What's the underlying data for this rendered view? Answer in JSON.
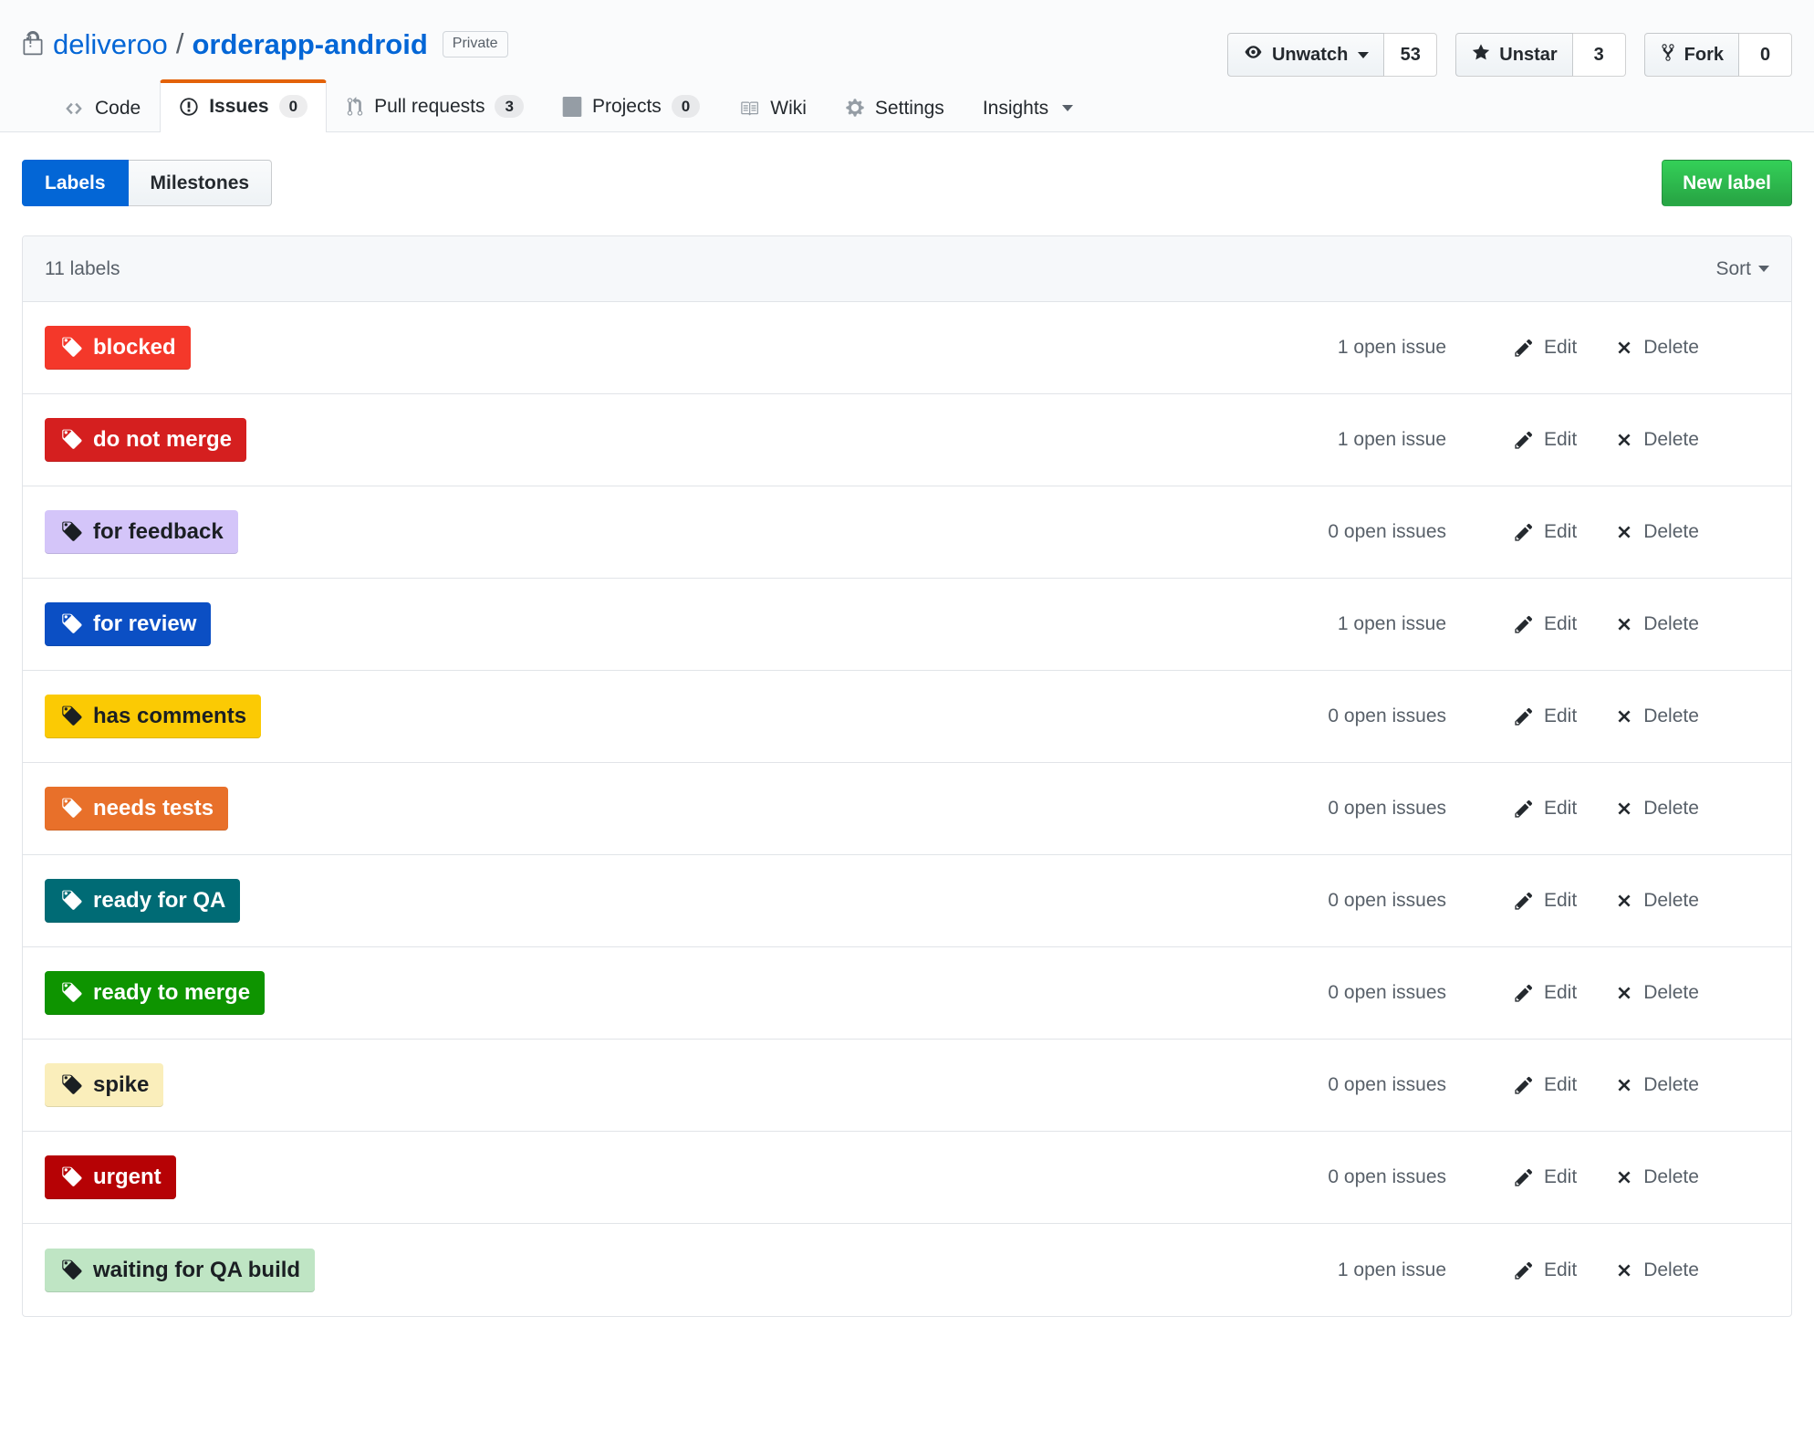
{
  "repo": {
    "lock_icon": "lock-icon",
    "owner": "deliveroo",
    "separator": "/",
    "name": "orderapp-android",
    "visibility": "Private"
  },
  "actions": [
    {
      "icon": "eye-icon",
      "label": "Unwatch",
      "count": "53",
      "has_caret": true
    },
    {
      "icon": "star-icon",
      "label": "Unstar",
      "count": "3",
      "has_caret": false
    },
    {
      "icon": "fork-icon",
      "label": "Fork",
      "count": "0",
      "has_caret": false
    }
  ],
  "nav": {
    "tabs": [
      {
        "icon": "code-icon",
        "label": "Code",
        "count": null,
        "selected": false
      },
      {
        "icon": "issue-opened-icon",
        "label": "Issues",
        "count": "0",
        "selected": true
      },
      {
        "icon": "git-pull-request-icon",
        "label": "Pull requests",
        "count": "3",
        "selected": false
      },
      {
        "icon": "project-icon",
        "label": "Projects",
        "count": "0",
        "selected": false
      },
      {
        "icon": "book-icon",
        "label": "Wiki",
        "count": null,
        "selected": false
      },
      {
        "icon": "gear-icon",
        "label": "Settings",
        "count": null,
        "selected": false
      },
      {
        "icon": "graph-icon",
        "label": "Insights",
        "count": null,
        "selected": false,
        "has_caret": true
      }
    ]
  },
  "subnav": {
    "labels_tab": "Labels",
    "milestones_tab": "Milestones",
    "new_label_button": "New label"
  },
  "list_header": {
    "count_text": "11 labels",
    "sort_label": "Sort"
  },
  "row_actions": {
    "edit_label": "Edit",
    "delete_label": "Delete"
  },
  "labels": [
    {
      "name": "blocked",
      "bg": "#f4382a",
      "fg": "#ffffff",
      "issues": "1 open issue"
    },
    {
      "name": "do not merge",
      "bg": "#d51f1f",
      "fg": "#ffffff",
      "issues": "1 open issue"
    },
    {
      "name": "for feedback",
      "bg": "#d4c5f9",
      "fg": "#1b1f23",
      "issues": "0 open issues"
    },
    {
      "name": "for review",
      "bg": "#0b4fc4",
      "fg": "#ffffff",
      "issues": "1 open issue"
    },
    {
      "name": "has comments",
      "bg": "#fbca04",
      "fg": "#1b1f23",
      "issues": "0 open issues"
    },
    {
      "name": "needs tests",
      "bg": "#e8702a",
      "fg": "#ffffff",
      "issues": "0 open issues"
    },
    {
      "name": "ready for QA",
      "bg": "#006b75",
      "fg": "#ffffff",
      "issues": "0 open issues"
    },
    {
      "name": "ready to merge",
      "bg": "#0e9400",
      "fg": "#ffffff",
      "issues": "0 open issues"
    },
    {
      "name": "spike",
      "bg": "#faeebb",
      "fg": "#1b1f23",
      "issues": "0 open issues"
    },
    {
      "name": "urgent",
      "bg": "#b60205",
      "fg": "#ffffff",
      "issues": "0 open issues"
    },
    {
      "name": "waiting for QA build",
      "bg": "#bfe5c4",
      "fg": "#1b1f23",
      "issues": "1 open issue"
    }
  ],
  "colors": {
    "link": "#0366d6",
    "active_tab_border": "#e36209",
    "primary_green": "#28a745",
    "muted_text": "#586069",
    "border": "#e1e4e8"
  }
}
